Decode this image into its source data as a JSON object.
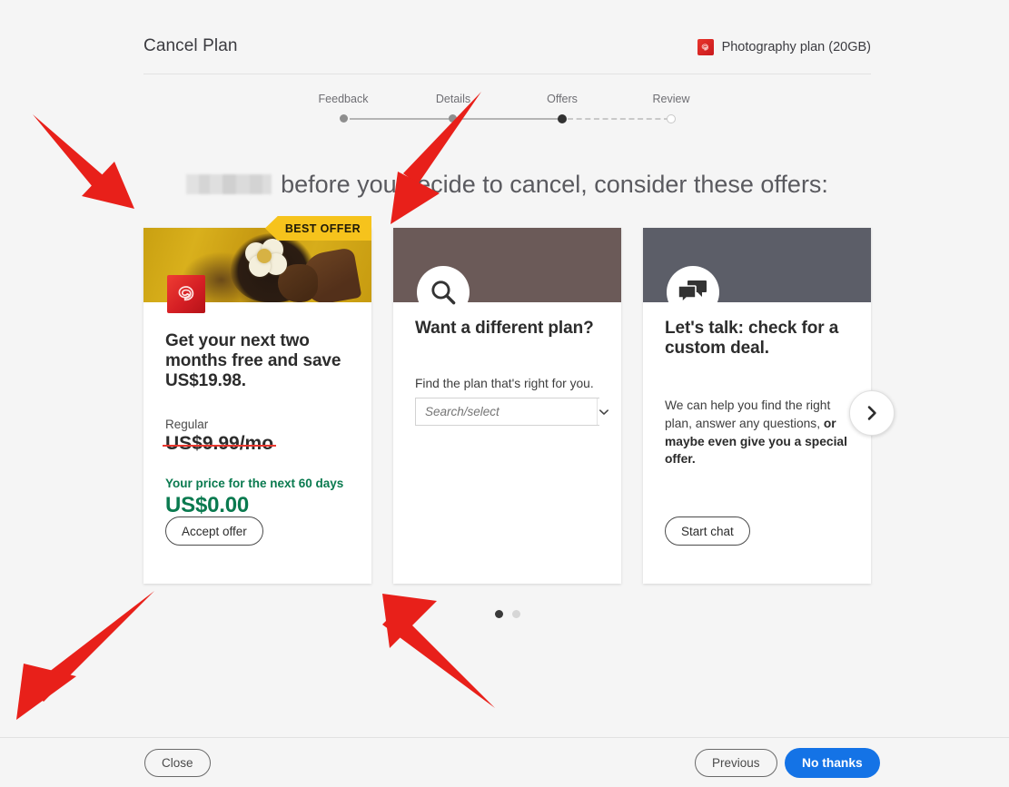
{
  "header": {
    "title": "Cancel Plan",
    "plan_badge": {
      "icon": "creative-cloud-icon",
      "label": "Photography plan (20GB)"
    }
  },
  "stepper": {
    "steps": [
      {
        "label": "Feedback",
        "state": "done"
      },
      {
        "label": "Details",
        "state": "done"
      },
      {
        "label": "Offers",
        "state": "current"
      },
      {
        "label": "Review",
        "state": "upcoming"
      }
    ]
  },
  "headline": {
    "redacted_name": "",
    "text": "before you decide to cancel, consider these offers:"
  },
  "cards": [
    {
      "id": "offer-two-months-free",
      "ribbon": "BEST OFFER",
      "hero": "photo-woman-with-flower",
      "logo": "creative-cloud-icon",
      "title": "Get your next two months free and save US$19.98.",
      "regular_label": "Regular",
      "regular_price": "US$9.99/mo",
      "promo_label": "Your price for the next 60 days",
      "promo_price": "US$0.00",
      "button": "Accept offer"
    },
    {
      "id": "offer-different-plan",
      "hero": "search-icon",
      "title": "Want a different plan?",
      "subtitle": "Find the plan that's right for you.",
      "select_placeholder": "Search/select",
      "select_value": "",
      "caret": "chevron-down-icon"
    },
    {
      "id": "offer-custom-deal",
      "hero": "chat-bubbles-icon",
      "title": "Let's talk: check for a custom deal.",
      "body_normal": "We can help you find the right plan, answer any questions, ",
      "body_bold": "or maybe even give you a special offer.",
      "button": "Start chat"
    }
  ],
  "carousel": {
    "next_label": "next-slide",
    "dots": [
      "active",
      "inactive"
    ]
  },
  "footer": {
    "close": "Close",
    "previous": "Previous",
    "no_thanks": "No thanks"
  },
  "colors": {
    "accent_blue": "#1473e6",
    "ribbon_yellow": "#f6c31c",
    "promo_green": "#0a7a4f",
    "strike_red": "#e8382f",
    "card2_header": "#6b5a58",
    "card3_header": "#5c5e68",
    "page_bg": "#f5f5f5",
    "annotation_red": "#e8201a"
  }
}
